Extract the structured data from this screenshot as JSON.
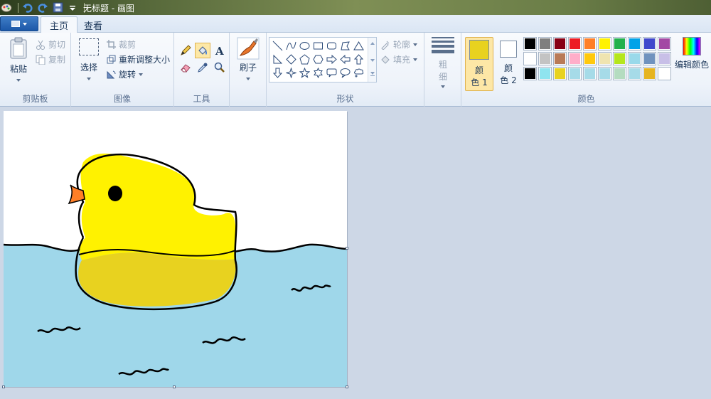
{
  "window": {
    "title": "无标题 - 画图"
  },
  "tabs": [
    {
      "label": "主页",
      "active": true
    },
    {
      "label": "查看",
      "active": false
    }
  ],
  "clipboard": {
    "group_label": "剪贴板",
    "paste": "粘贴",
    "cut": "剪切",
    "copy": "复制"
  },
  "image": {
    "group_label": "图像",
    "select": "选择",
    "crop": "裁剪",
    "resize": "重新调整大小",
    "rotate": "旋转"
  },
  "tools": {
    "group_label": "工具",
    "items": [
      "pencil-icon",
      "fill-bucket-icon",
      "text-icon",
      "eraser-icon",
      "color-picker-icon",
      "magnifier-icon"
    ],
    "selected": "fill-bucket-icon"
  },
  "brushes": {
    "label": "刷子"
  },
  "shapes": {
    "group_label": "形状",
    "outline": "轮廓",
    "fill": "填充",
    "items": [
      "line",
      "curve",
      "oval",
      "rectangle",
      "rounded-rectangle",
      "polygon",
      "triangle",
      "right-triangle",
      "diamond",
      "pentagon",
      "hexagon",
      "right-arrow",
      "left-arrow",
      "up-arrow",
      "down-arrow",
      "four-point-star",
      "five-point-star",
      "six-point-star",
      "rounded-callout",
      "oval-callout",
      "cloud-callout"
    ]
  },
  "size": {
    "label_line1": "粗",
    "label_line2": "细"
  },
  "colors": {
    "group_label": "颜色",
    "color1_label_a": "颜",
    "color1_label_b": "色 1",
    "color2_label_a": "颜",
    "color2_label_b": "色 2",
    "color1": "#e8d21f",
    "color2": "#ffffff",
    "edit_label": "编辑颜色",
    "palette": [
      "#000000",
      "#7f7f7f",
      "#880015",
      "#ed1c24",
      "#ff7f27",
      "#fff200",
      "#22b14c",
      "#00a2e8",
      "#3f48cc",
      "#a349a4",
      "#ffffff",
      "#c3c3c3",
      "#b97a57",
      "#ffaec9",
      "#ffc90e",
      "#efe4b0",
      "#b5e61d",
      "#99d9ea",
      "#7092be",
      "#c8bfe7",
      "#000000",
      "#8fe4ef",
      "#e8d21f",
      "#a6dbe8",
      "#a6dbe8",
      "#a6dbe8",
      "#b4dcc0",
      "#a6dbe8",
      "#e6b420",
      "#ffffff"
    ]
  },
  "drawing": {
    "sky": "#ffffff",
    "water": "#9fd7ea",
    "duck_body": "#fff200",
    "duck_shade": "#e8d21f",
    "beak": "#ff7f27",
    "outline": "#000000"
  }
}
